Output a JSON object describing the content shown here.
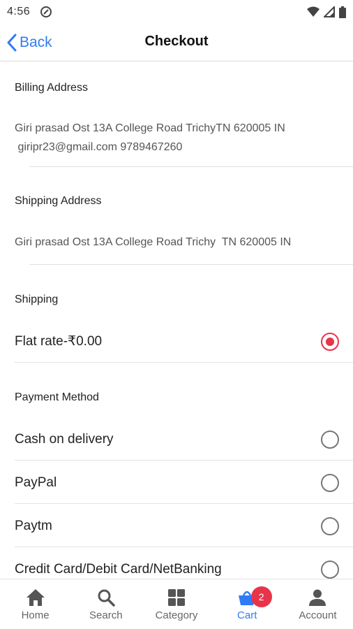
{
  "status_bar": {
    "time": "4:56"
  },
  "header": {
    "back_label": "Back",
    "title": "Checkout"
  },
  "billing": {
    "title": "Billing Address",
    "line1": "Giri prasad Ost 13A College Road TrichyTN 620005 IN",
    "line2": " giripr23@gmail.com 9789467260"
  },
  "shipping_address": {
    "title": "Shipping Address",
    "text": "Giri prasad Ost 13A College Road Trichy  TN 620005 IN"
  },
  "shipping": {
    "title": "Shipping",
    "options": [
      {
        "label": "Flat rate-₹0.00",
        "selected": true
      }
    ]
  },
  "payment": {
    "title": "Payment Method",
    "options": [
      {
        "label": "Cash on delivery",
        "selected": false
      },
      {
        "label": "PayPal",
        "selected": false
      },
      {
        "label": "Paytm",
        "selected": false
      },
      {
        "label": "Credit Card/Debit Card/NetBanking",
        "selected": false
      }
    ]
  },
  "bottom_nav": {
    "items": [
      {
        "label": "Home",
        "icon": "home-icon"
      },
      {
        "label": "Search",
        "icon": "search-icon"
      },
      {
        "label": "Category",
        "icon": "grid-icon"
      },
      {
        "label": "Cart",
        "icon": "cart-icon",
        "active": true,
        "badge": "2"
      },
      {
        "label": "Account",
        "icon": "person-icon"
      }
    ]
  },
  "colors": {
    "accent_blue": "#2f7bf5",
    "accent_red": "#e8344a"
  }
}
